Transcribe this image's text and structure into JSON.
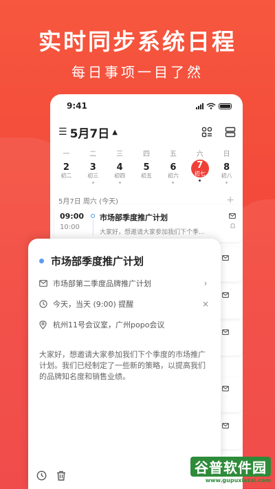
{
  "promo": {
    "headline": "实时同步系统日程",
    "subline": "每日事项一目了然"
  },
  "status_bar": {
    "time": "9:41"
  },
  "calendar": {
    "month_title": "5月7日",
    "weekdays": [
      "一",
      "二",
      "三",
      "四",
      "五",
      "六",
      "日"
    ],
    "dates": [
      {
        "day": "2",
        "lunar": "初二"
      },
      {
        "day": "3",
        "lunar": "初三"
      },
      {
        "day": "4",
        "lunar": "初四"
      },
      {
        "day": "5",
        "lunar": "初五"
      },
      {
        "day": "6",
        "lunar": "初六"
      },
      {
        "day": "7",
        "lunar": "初七"
      },
      {
        "day": "8",
        "lunar": "初八"
      }
    ],
    "selected_index": 5,
    "day_label": "5月7日 周六 (今天)"
  },
  "event_list": [
    {
      "start": "09:00",
      "end": "10:00",
      "title": "市场部季度推广计划",
      "desc": "大家好，想邀请大家参加我们下个季..."
    }
  ],
  "detail": {
    "title": "市场部季度推广计划",
    "email_subject": "市场部第二季度品牌推广计划",
    "reminder": "今天，当天 (9:00) 提醒",
    "location": "杭州11号会议室，广州popo会议",
    "description": "大家好，想邀请大家参加我们下个季度的市场推广计划。我们已经制定了一些新的策略，以提高我们的品牌知名度和销售业绩。"
  },
  "watermark": {
    "main": "谷普软件园",
    "url": "www.gupuxiazai.com"
  },
  "colors": {
    "brand_red": "#ef4038",
    "event_blue": "#5b9cf0"
  }
}
